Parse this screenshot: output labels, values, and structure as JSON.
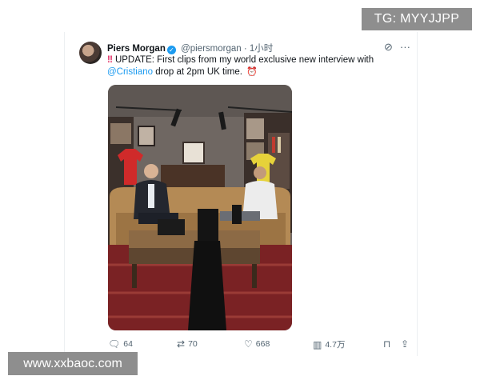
{
  "watermarks": {
    "top": "TG: MYYJJPP",
    "bottom": "www.xxbaoc.com"
  },
  "tweet": {
    "author_name": "Piers Morgan",
    "handle": "@piersmorgan",
    "time_ago": "· 1小时",
    "text_prefix": "‼",
    "text_line1": "UPDATE: First clips from my world exclusive new interview with",
    "mention": "@Cristiano",
    "text_line2": "drop at 2pm UK time.",
    "text_suffix": "⏰",
    "accent_color": "#1d9bf0"
  },
  "actions": {
    "replies": "64",
    "retweets": "70",
    "likes": "668",
    "views": "4.7万"
  },
  "icons": [
    "verified-badge-icon",
    "grok-icon",
    "more-icon",
    "reply-icon",
    "retweet-icon",
    "like-icon",
    "views-icon",
    "bookmark-icon",
    "share-icon"
  ]
}
